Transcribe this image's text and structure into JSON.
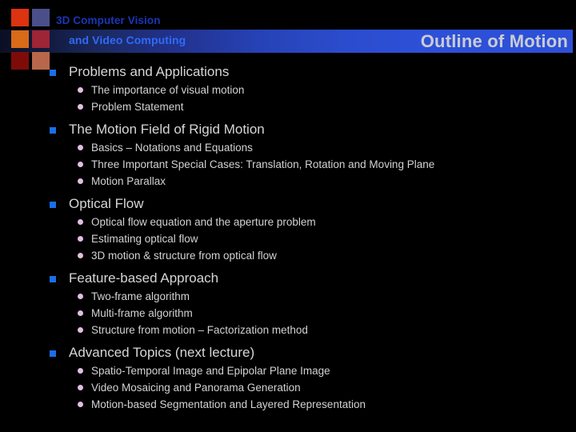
{
  "theme": {
    "background": "#000000",
    "band_start": "#0b0f24",
    "band_end": "#2d50d8",
    "title_color": "#c9ccd4",
    "level1_bullet_color": "#1a6fe8",
    "level2_bullet_color": "#e2bfe0",
    "body_text_color": "#d6d6d6"
  },
  "header": {
    "course_line1": "3D Computer Vision",
    "course_line2": "and Video Computing",
    "slide_title": "Outline of Motion",
    "decor_squares": [
      {
        "name": "decor-square-orange-red",
        "color": "#dd3310"
      },
      {
        "name": "decor-square-slate-blue",
        "color": "#4a4f8c"
      },
      {
        "name": "decor-square-orange",
        "color": "#d96a18"
      },
      {
        "name": "decor-square-crimson",
        "color": "#9e2436"
      },
      {
        "name": "decor-square-dark-red",
        "color": "#7d0c09"
      },
      {
        "name": "decor-square-salmon",
        "color": "#b9674a"
      }
    ]
  },
  "outline": [
    {
      "title": "Problems and Applications",
      "items": [
        "The importance of visual motion",
        "Problem Statement"
      ]
    },
    {
      "title": "The Motion Field of Rigid Motion",
      "items": [
        "Basics – Notations and Equations",
        "Three Important Special Cases: Translation, Rotation and Moving Plane",
        "Motion Parallax"
      ]
    },
    {
      "title": "Optical Flow",
      "items": [
        "Optical flow equation and the aperture problem",
        "Estimating optical flow",
        "3D motion & structure from optical flow"
      ]
    },
    {
      "title": "Feature-based Approach",
      "items": [
        "Two-frame algorithm",
        "Multi-frame  algorithm",
        "Structure from motion – Factorization method"
      ]
    },
    {
      "title": "Advanced Topics (next lecture)",
      "items": [
        "Spatio-Temporal Image and Epipolar Plane Image",
        "Video Mosaicing and Panorama Generation",
        "Motion-based Segmentation and Layered Representation"
      ]
    }
  ]
}
